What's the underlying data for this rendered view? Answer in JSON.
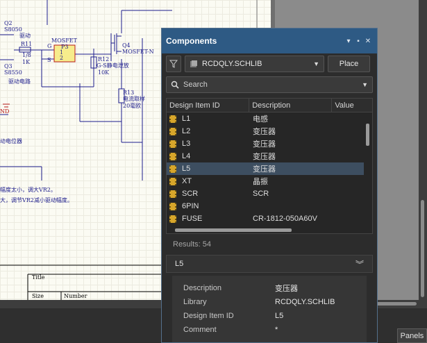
{
  "schematic": {
    "labels": {
      "q2": "Q2",
      "s8050": "S8050",
      "drive_label": "驱动",
      "r11": "R11",
      "r11_val": "1/8",
      "r11_val2": "1K",
      "q3": "Q3",
      "s8550": "S8550",
      "drive_circuit": "驱动电路",
      "nd": "ND",
      "mosfet": "MOSFET",
      "p3": "P3",
      "pin_g": "G",
      "pin_1": "1",
      "pin_2": "2",
      "pin_s": "S",
      "q4": "Q4",
      "q4_type": "MOSFET-N",
      "r12": "R12",
      "r12_desc": "G-S静电泄放",
      "r12_val": "10K",
      "r13": "R13",
      "r13_desc": "电流取样",
      "r13_val": "20毫欧",
      "pot_label": "动电位器",
      "note1": "幅度太小，调大VR2。",
      "note2": "大，调节VR2减小驱动幅度。",
      "title_cell": "Title",
      "size_cell": "Size",
      "number_cell": "Number"
    }
  },
  "panels_button": "Panels",
  "panel": {
    "title": "Components",
    "library": "RCDQLY.SCHLIB",
    "place_label": "Place",
    "search_placeholder": "Search",
    "columns": [
      "Design Item ID",
      "Description",
      "Value"
    ],
    "rows": [
      {
        "id": "L1",
        "desc": "电感",
        "selected": false
      },
      {
        "id": "L2",
        "desc": "变压器",
        "selected": false
      },
      {
        "id": "L3",
        "desc": "变压器",
        "selected": false
      },
      {
        "id": "L4",
        "desc": "变压器",
        "selected": false
      },
      {
        "id": "L5",
        "desc": "变压器",
        "selected": true
      },
      {
        "id": "XT",
        "desc": "晶振",
        "selected": false
      },
      {
        "id": "SCR",
        "desc": "SCR",
        "selected": false
      },
      {
        "id": "6PIN",
        "desc": "",
        "selected": false
      },
      {
        "id": "FUSE",
        "desc": "CR-1812-050A60V",
        "selected": false
      }
    ],
    "results": "Results: 54",
    "detail": {
      "title": "L5",
      "rows": [
        {
          "key": "Description",
          "value": "变压器"
        },
        {
          "key": "Library",
          "value": "RCDQLY.SCHLIB"
        },
        {
          "key": "Design Item ID",
          "value": "L5"
        },
        {
          "key": "Comment",
          "value": "*"
        }
      ]
    }
  },
  "colors": {
    "accent": "#2e5a84",
    "selection": "#3d4e60",
    "component_fill": "#f6ec8c"
  }
}
